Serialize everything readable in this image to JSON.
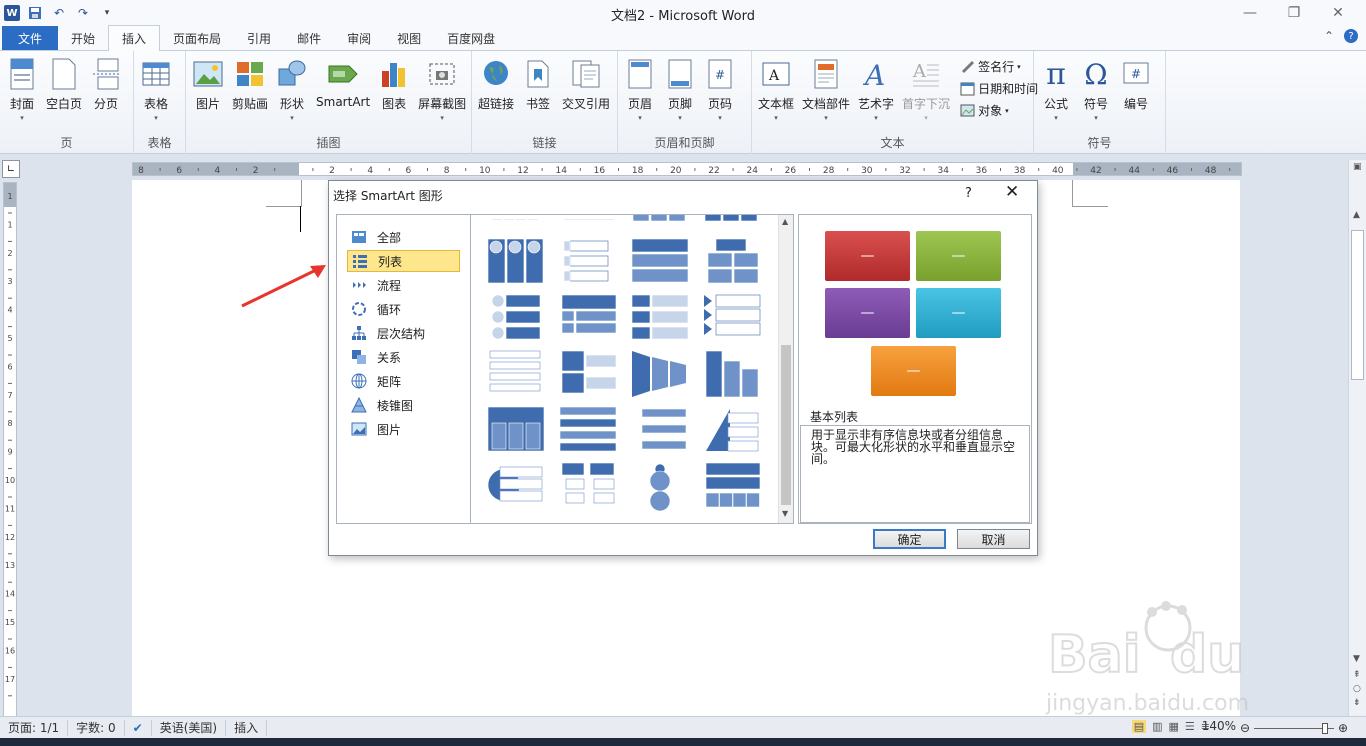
{
  "window": {
    "title": "文档2 - Microsoft Word",
    "colors": {
      "accent": "#2b579a",
      "file_tab": "#2b6cc4"
    }
  },
  "tabs": [
    {
      "label": "文件"
    },
    {
      "label": "开始"
    },
    {
      "label": "插入"
    },
    {
      "label": "页面布局"
    },
    {
      "label": "引用"
    },
    {
      "label": "邮件"
    },
    {
      "label": "审阅"
    },
    {
      "label": "视图"
    },
    {
      "label": "百度网盘"
    }
  ],
  "ribbon": {
    "groups": {
      "page": {
        "label": "页",
        "buttons": [
          "封面",
          "空白页",
          "分页"
        ]
      },
      "table": {
        "label": "表格",
        "buttons": [
          "表格"
        ]
      },
      "illustrations": {
        "label": "插图",
        "buttons": [
          "图片",
          "剪贴画",
          "形状",
          "SmartArt",
          "图表",
          "屏幕截图"
        ]
      },
      "links": {
        "label": "链接",
        "buttons": [
          "超链接",
          "书签",
          "交叉引用"
        ]
      },
      "header_footer": {
        "label": "页眉和页脚",
        "buttons": [
          "页眉",
          "页脚",
          "页码"
        ]
      },
      "text": {
        "label": "文本",
        "buttons": [
          "文本框",
          "文档部件",
          "艺术字",
          "首字下沉"
        ],
        "small": [
          "签名行",
          "日期和时间",
          "对象"
        ]
      },
      "symbols": {
        "label": "符号",
        "buttons": [
          "公式",
          "符号",
          "编号"
        ]
      }
    }
  },
  "ruler": {
    "h_ticks": [
      "8",
      "6",
      "4",
      "2",
      "",
      "2",
      "4",
      "6",
      "8",
      "10",
      "12",
      "14",
      "16",
      "18",
      "20",
      "22",
      "24",
      "26",
      "28",
      "30",
      "32",
      "34",
      "36",
      "38",
      "40",
      "42",
      "44",
      "46",
      "48"
    ],
    "v_ticks": [
      "1",
      "1",
      "2",
      "3",
      "4",
      "5",
      "6",
      "7",
      "8",
      "9",
      "10",
      "11",
      "12",
      "13",
      "14",
      "15",
      "16",
      "17"
    ]
  },
  "dialog": {
    "title": "选择 SmartArt 图形",
    "help": "?",
    "close": "✕",
    "categories": [
      {
        "label": "全部",
        "icon": "all-icon"
      },
      {
        "label": "列表",
        "icon": "list-icon",
        "selected": true
      },
      {
        "label": "流程",
        "icon": "process-icon"
      },
      {
        "label": "循环",
        "icon": "cycle-icon"
      },
      {
        "label": "层次结构",
        "icon": "hierarchy-icon"
      },
      {
        "label": "关系",
        "icon": "relationship-icon"
      },
      {
        "label": "矩阵",
        "icon": "matrix-icon"
      },
      {
        "label": "棱锥图",
        "icon": "pyramid-icon"
      },
      {
        "label": "图片",
        "icon": "picture-icon"
      }
    ],
    "preview": {
      "name": "基本列表",
      "description": "用于显示非有序信息块或者分组信息块。可最大化形状的水平和垂直显示空间。",
      "box_colors": [
        "#c8393a",
        "#89b13a",
        "#7a4ba2",
        "#2fb0d3",
        "#f08a22"
      ],
      "box_text": "—"
    },
    "ok": "确定",
    "cancel": "取消"
  },
  "statusbar": {
    "page": "页面: 1/1",
    "words": "字数: 0",
    "language": "英语(美国)",
    "mode": "插入",
    "zoom": "140%"
  }
}
